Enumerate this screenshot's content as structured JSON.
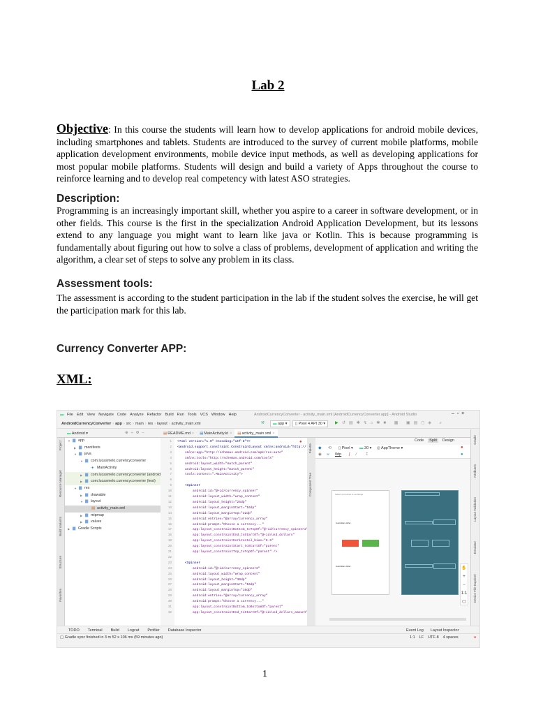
{
  "doc": {
    "title": "Lab 2",
    "objective_heading": "Objective",
    "objective_text": ": In this course the students will learn how to develop applications for android mobile devices, including smartphones and tablets. Students are introduced to the survey of current mobile platforms, mobile application development environments, mobile device input methods, as well as developing applications for most popular mobile platforms. Students will design and build a variety of Apps throughout the course to reinforce learning and to develop real competency with latest ASO strategies.",
    "description_heading": "Description:",
    "description_text": "Programming is an increasingly important skill, whether you aspire to a career in software development, or in other fields. This course is the first in the specialization Android Application Development, but its lessons extend to any language you might want to learn like java or Kotlin. This is because programming is fundamentally about figuring out how to solve a class of problems, development of application and writing the algorithm, a clear set of steps to solve any problem in its class.",
    "assessment_heading": "Assessment tools:",
    "assessment_text": "The assessment is according to the student participation in the lab if the student solves the exercise, he will get the participation mark for this lab.",
    "app_heading": "Currency Converter APP:",
    "xml_heading": "XML:",
    "page_number": "1"
  },
  "ide": {
    "menu": [
      "File",
      "Edit",
      "View",
      "Navigate",
      "Code",
      "Analyze",
      "Refactor",
      "Build",
      "Run",
      "Tools",
      "VCS",
      "Window",
      "Help"
    ],
    "window_title": "AndroidCurrencyConverter - activity_main.xml [AndroidCurrencyConverter.app] - Android Studio",
    "breadcrumb": [
      "AndroidCurrencyConverter",
      "app",
      "src",
      "main",
      "res",
      "layout",
      "activity_main.xml"
    ],
    "run_config": "app",
    "device": "Pixel 4 API 30",
    "project_view": "Android",
    "editor_tabs": [
      "README.md",
      "MainActivity.kt",
      "activity_main.xml"
    ],
    "active_tab": 2,
    "view_modes": [
      "Code",
      "Split",
      "Design"
    ],
    "tree": [
      {
        "label": "app",
        "indent": 0,
        "arrow": "▼"
      },
      {
        "label": "manifests",
        "indent": 1,
        "arrow": "▶"
      },
      {
        "label": "java",
        "indent": 1,
        "arrow": "▼"
      },
      {
        "label": "com.lucasmelo.currencyconverter",
        "indent": 2,
        "arrow": "▼"
      },
      {
        "label": "MainActivity",
        "indent": 3,
        "arrow": ""
      },
      {
        "label": "com.lucasmelo.currencyconverter (androidTest)",
        "indent": 2,
        "arrow": "▶",
        "hl": "grn"
      },
      {
        "label": "com.lucasmelo.currencyconverter (test)",
        "indent": 2,
        "arrow": "▶",
        "hl": "grn"
      },
      {
        "label": "res",
        "indent": 1,
        "arrow": "▼"
      },
      {
        "label": "drawable",
        "indent": 2,
        "arrow": "▶"
      },
      {
        "label": "layout",
        "indent": 2,
        "arrow": "▼"
      },
      {
        "label": "activity_main.xml",
        "indent": 3,
        "arrow": "",
        "hl": "sel"
      },
      {
        "label": "mipmap",
        "indent": 2,
        "arrow": "▶"
      },
      {
        "label": "values",
        "indent": 2,
        "arrow": "▶"
      },
      {
        "label": "Gradle Scripts",
        "indent": 0,
        "arrow": "▶"
      }
    ],
    "code": [
      "<?xml version=\"1.0\" encoding=\"utf-8\"?>",
      "<android.support.constraint.ConstraintLayout xmlns:android=\"http://",
      "    xmlns:app=\"http://schemas.android.com/apk/res-auto\"",
      "    xmlns:tools=\"http://schemas.android.com/tools\"",
      "    android:layout_width=\"match_parent\"",
      "    android:layout_height=\"match_parent\"",
      "    tools:context=\".MainActivity\">",
      "",
      "    <Spinner",
      "        android:id=\"@+id/currency_spinner\"",
      "        android:layout_width=\"wrap_content\"",
      "        android:layout_height=\"25dp\"",
      "        android:layout_marginStart=\"16dp\"",
      "        android:layout_marginTop=\"32dp\"",
      "        android:entries=\"@array/currency_array\"",
      "        android:prompt=\"Choose a currency...\"",
      "        app:layout_constraintBottom_toTopOf=\"@+id/currency_spinner2\"",
      "        app:layout_constraintEnd_toStartOf=\"@+id/usd_dollars\"",
      "        app:layout_constraintHorizontal_bias=\"0.5\"",
      "        app:layout_constraintStart_toStartOf=\"parent\"",
      "        app:layout_constraintTop_toTopOf=\"parent\" />",
      "",
      "    <Spinner",
      "        android:id=\"@+id/currency_spinner2\"",
      "        android:layout_width=\"wrap_content\"",
      "        android:layout_height=\"30dp\"",
      "        android:layout_marginStart=\"16dp\"",
      "        android:layout_marginTop=\"16dp\"",
      "        android:entries=\"@array/currency_array\"",
      "        android:prompt=\"Choose a currency...\"",
      "        app:layout_constraintBottom_toBottomOf=\"parent\"",
      "        app:layout_constraintEnd_toStartOf=\"@+id/usd_dollars_amount\""
    ],
    "design_toolbar": {
      "device": "Pixel",
      "api": "30",
      "theme": "AppTheme",
      "dp": "0dp"
    },
    "preview": {
      "header": "Select currencies to exchange",
      "spinner1": "Australian dollar",
      "spinner2": "Australian dollar",
      "btn_red_color": "#f0553a",
      "btn_green_color": "#5bb64a"
    },
    "blueprint_color": "#3a6f80",
    "left_tools": [
      "Project",
      "Resource Manager",
      "Build Variants",
      "Structure",
      "Favorites"
    ],
    "right_tools": [
      "Gradle",
      "Attributes",
      "Layout Validation",
      "Emulator",
      "Device File Explorer"
    ],
    "palette_tools": [
      "Palette",
      "Component Tree"
    ],
    "bottom_tools": [
      "TODO",
      "Terminal",
      "Build",
      "Logcat",
      "Profiler",
      "Database Inspector"
    ],
    "bottom_right_tools": [
      "Event Log",
      "Layout Inspector"
    ],
    "status": "Gradle sync finished in 3 m 52 s 106 ms (59 minutes ago)",
    "status_right": [
      "1:1",
      "LF",
      "UTF-8",
      "4 spaces"
    ]
  }
}
